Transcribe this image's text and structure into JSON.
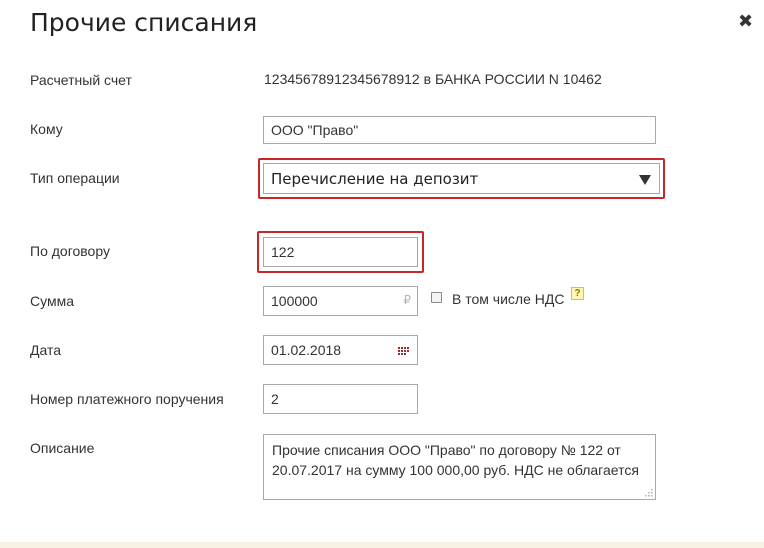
{
  "dialog": {
    "title": "Прочие списания",
    "close_icon": "close-icon"
  },
  "fields": {
    "account": {
      "label": "Расчетный счет",
      "value": "12345678912345678912 в БАНКА РОССИИ N 10462"
    },
    "to": {
      "label": "Кому",
      "value": "ООО \"Право\""
    },
    "operation_type": {
      "label": "Тип операции",
      "value": "Перечисление на депозит"
    },
    "contract": {
      "label": "По договору",
      "value": "122"
    },
    "amount": {
      "label": "Сумма",
      "value": "100000",
      "currency_symbol": "₽",
      "vat_checkbox_label": "В том числе НДС",
      "vat_checked": false,
      "help_symbol": "?"
    },
    "date": {
      "label": "Дата",
      "value": "01.02.2018"
    },
    "payment_order_number": {
      "label": "Номер платежного поручения",
      "value": "2"
    },
    "description": {
      "label": "Описание",
      "value": "Прочие списания ООО \"Право\" по договору № 122 от 20.07.2017 на сумму 100 000,00 руб. НДС не облагается"
    }
  },
  "colors": {
    "highlight_border": "#c62828",
    "footer_bg": "#f7f2e4"
  }
}
